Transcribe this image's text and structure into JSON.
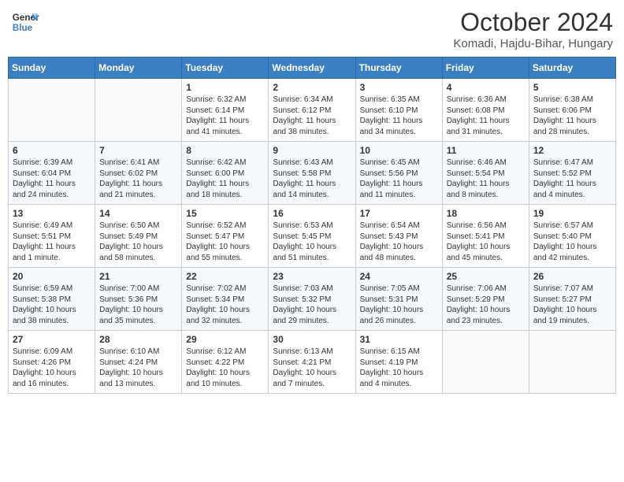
{
  "header": {
    "logo_general": "General",
    "logo_blue": "Blue",
    "month_title": "October 2024",
    "location": "Komadi, Hajdu-Bihar, Hungary"
  },
  "days_of_week": [
    "Sunday",
    "Monday",
    "Tuesday",
    "Wednesday",
    "Thursday",
    "Friday",
    "Saturday"
  ],
  "weeks": [
    [
      {
        "num": "",
        "sunrise": "",
        "sunset": "",
        "daylight": ""
      },
      {
        "num": "",
        "sunrise": "",
        "sunset": "",
        "daylight": ""
      },
      {
        "num": "1",
        "sunrise": "Sunrise: 6:32 AM",
        "sunset": "Sunset: 6:14 PM",
        "daylight": "Daylight: 11 hours and 41 minutes."
      },
      {
        "num": "2",
        "sunrise": "Sunrise: 6:34 AM",
        "sunset": "Sunset: 6:12 PM",
        "daylight": "Daylight: 11 hours and 38 minutes."
      },
      {
        "num": "3",
        "sunrise": "Sunrise: 6:35 AM",
        "sunset": "Sunset: 6:10 PM",
        "daylight": "Daylight: 11 hours and 34 minutes."
      },
      {
        "num": "4",
        "sunrise": "Sunrise: 6:36 AM",
        "sunset": "Sunset: 6:08 PM",
        "daylight": "Daylight: 11 hours and 31 minutes."
      },
      {
        "num": "5",
        "sunrise": "Sunrise: 6:38 AM",
        "sunset": "Sunset: 6:06 PM",
        "daylight": "Daylight: 11 hours and 28 minutes."
      }
    ],
    [
      {
        "num": "6",
        "sunrise": "Sunrise: 6:39 AM",
        "sunset": "Sunset: 6:04 PM",
        "daylight": "Daylight: 11 hours and 24 minutes."
      },
      {
        "num": "7",
        "sunrise": "Sunrise: 6:41 AM",
        "sunset": "Sunset: 6:02 PM",
        "daylight": "Daylight: 11 hours and 21 minutes."
      },
      {
        "num": "8",
        "sunrise": "Sunrise: 6:42 AM",
        "sunset": "Sunset: 6:00 PM",
        "daylight": "Daylight: 11 hours and 18 minutes."
      },
      {
        "num": "9",
        "sunrise": "Sunrise: 6:43 AM",
        "sunset": "Sunset: 5:58 PM",
        "daylight": "Daylight: 11 hours and 14 minutes."
      },
      {
        "num": "10",
        "sunrise": "Sunrise: 6:45 AM",
        "sunset": "Sunset: 5:56 PM",
        "daylight": "Daylight: 11 hours and 11 minutes."
      },
      {
        "num": "11",
        "sunrise": "Sunrise: 6:46 AM",
        "sunset": "Sunset: 5:54 PM",
        "daylight": "Daylight: 11 hours and 8 minutes."
      },
      {
        "num": "12",
        "sunrise": "Sunrise: 6:47 AM",
        "sunset": "Sunset: 5:52 PM",
        "daylight": "Daylight: 11 hours and 4 minutes."
      }
    ],
    [
      {
        "num": "13",
        "sunrise": "Sunrise: 6:49 AM",
        "sunset": "Sunset: 5:51 PM",
        "daylight": "Daylight: 11 hours and 1 minute."
      },
      {
        "num": "14",
        "sunrise": "Sunrise: 6:50 AM",
        "sunset": "Sunset: 5:49 PM",
        "daylight": "Daylight: 10 hours and 58 minutes."
      },
      {
        "num": "15",
        "sunrise": "Sunrise: 6:52 AM",
        "sunset": "Sunset: 5:47 PM",
        "daylight": "Daylight: 10 hours and 55 minutes."
      },
      {
        "num": "16",
        "sunrise": "Sunrise: 6:53 AM",
        "sunset": "Sunset: 5:45 PM",
        "daylight": "Daylight: 10 hours and 51 minutes."
      },
      {
        "num": "17",
        "sunrise": "Sunrise: 6:54 AM",
        "sunset": "Sunset: 5:43 PM",
        "daylight": "Daylight: 10 hours and 48 minutes."
      },
      {
        "num": "18",
        "sunrise": "Sunrise: 6:56 AM",
        "sunset": "Sunset: 5:41 PM",
        "daylight": "Daylight: 10 hours and 45 minutes."
      },
      {
        "num": "19",
        "sunrise": "Sunrise: 6:57 AM",
        "sunset": "Sunset: 5:40 PM",
        "daylight": "Daylight: 10 hours and 42 minutes."
      }
    ],
    [
      {
        "num": "20",
        "sunrise": "Sunrise: 6:59 AM",
        "sunset": "Sunset: 5:38 PM",
        "daylight": "Daylight: 10 hours and 38 minutes."
      },
      {
        "num": "21",
        "sunrise": "Sunrise: 7:00 AM",
        "sunset": "Sunset: 5:36 PM",
        "daylight": "Daylight: 10 hours and 35 minutes."
      },
      {
        "num": "22",
        "sunrise": "Sunrise: 7:02 AM",
        "sunset": "Sunset: 5:34 PM",
        "daylight": "Daylight: 10 hours and 32 minutes."
      },
      {
        "num": "23",
        "sunrise": "Sunrise: 7:03 AM",
        "sunset": "Sunset: 5:32 PM",
        "daylight": "Daylight: 10 hours and 29 minutes."
      },
      {
        "num": "24",
        "sunrise": "Sunrise: 7:05 AM",
        "sunset": "Sunset: 5:31 PM",
        "daylight": "Daylight: 10 hours and 26 minutes."
      },
      {
        "num": "25",
        "sunrise": "Sunrise: 7:06 AM",
        "sunset": "Sunset: 5:29 PM",
        "daylight": "Daylight: 10 hours and 23 minutes."
      },
      {
        "num": "26",
        "sunrise": "Sunrise: 7:07 AM",
        "sunset": "Sunset: 5:27 PM",
        "daylight": "Daylight: 10 hours and 19 minutes."
      }
    ],
    [
      {
        "num": "27",
        "sunrise": "Sunrise: 6:09 AM",
        "sunset": "Sunset: 4:26 PM",
        "daylight": "Daylight: 10 hours and 16 minutes."
      },
      {
        "num": "28",
        "sunrise": "Sunrise: 6:10 AM",
        "sunset": "Sunset: 4:24 PM",
        "daylight": "Daylight: 10 hours and 13 minutes."
      },
      {
        "num": "29",
        "sunrise": "Sunrise: 6:12 AM",
        "sunset": "Sunset: 4:22 PM",
        "daylight": "Daylight: 10 hours and 10 minutes."
      },
      {
        "num": "30",
        "sunrise": "Sunrise: 6:13 AM",
        "sunset": "Sunset: 4:21 PM",
        "daylight": "Daylight: 10 hours and 7 minutes."
      },
      {
        "num": "31",
        "sunrise": "Sunrise: 6:15 AM",
        "sunset": "Sunset: 4:19 PM",
        "daylight": "Daylight: 10 hours and 4 minutes."
      },
      {
        "num": "",
        "sunrise": "",
        "sunset": "",
        "daylight": ""
      },
      {
        "num": "",
        "sunrise": "",
        "sunset": "",
        "daylight": ""
      }
    ]
  ]
}
